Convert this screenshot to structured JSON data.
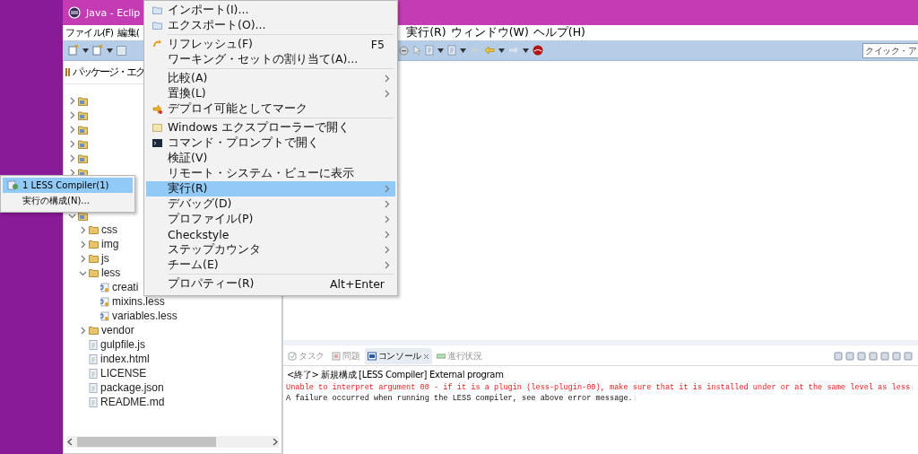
{
  "window": {
    "title": "Java - Eclip"
  },
  "menu_bar": [
    {
      "label": "ファイル(F)"
    },
    {
      "label": "編集("
    },
    {
      "label": "実行(R)"
    },
    {
      "label": "ウィンドウ(W)"
    },
    {
      "label": "ヘルプ(H)"
    }
  ],
  "quick_access": {
    "placeholder": "クイック・ア"
  },
  "package_explorer": {
    "title": "パッケージ・エク",
    "tree": [
      {
        "kind": "project",
        "expanded": false
      },
      {
        "kind": "project",
        "expanded": false
      },
      {
        "kind": "project",
        "expanded": false
      },
      {
        "kind": "project",
        "expanded": false
      },
      {
        "kind": "project",
        "expanded": false
      },
      {
        "kind": "project",
        "expanded": false
      },
      {
        "kind": "project",
        "expanded": true,
        "children": [
          {
            "kind": "folder",
            "label": "css",
            "expanded": false
          },
          {
            "kind": "folder",
            "label": "img",
            "expanded": false
          },
          {
            "kind": "folder",
            "label": "js",
            "expanded": false
          },
          {
            "kind": "folder",
            "label": "less",
            "expanded": true,
            "children": [
              {
                "kind": "less",
                "label": "creati"
              },
              {
                "kind": "less",
                "label": "mixins.less"
              },
              {
                "kind": "less",
                "label": "variables.less"
              }
            ]
          },
          {
            "kind": "folder",
            "label": "vendor",
            "expanded": false
          },
          {
            "kind": "file",
            "label": "gulpfile.js"
          },
          {
            "kind": "file",
            "label": "index.html"
          },
          {
            "kind": "file",
            "label": "LICENSE"
          },
          {
            "kind": "file",
            "label": "package.json"
          },
          {
            "kind": "file",
            "label": "README.md"
          }
        ]
      }
    ]
  },
  "context_menu": {
    "items": [
      {
        "kind": "item",
        "label": "インポート(I)...",
        "submenu": false,
        "selected": false
      },
      {
        "kind": "item",
        "label": "エクスポート(O)...",
        "submenu": false,
        "selected": false
      },
      {
        "kind": "separator"
      },
      {
        "kind": "item",
        "label": "リフレッシュ(F)",
        "shortcut": "F5",
        "submenu": false,
        "selected": false
      },
      {
        "kind": "item",
        "label": "ワーキング・セットの割り当て(A)...",
        "submenu": false,
        "selected": false
      },
      {
        "kind": "separator"
      },
      {
        "kind": "item",
        "label": "比較(A)",
        "submenu": true,
        "selected": false
      },
      {
        "kind": "item",
        "label": "置換(L)",
        "submenu": true,
        "selected": false
      },
      {
        "kind": "item",
        "label": "デプロイ可能としてマーク",
        "submenu": false,
        "selected": false
      },
      {
        "kind": "separator"
      },
      {
        "kind": "item",
        "label": "Windows エクスプローラーで開く",
        "submenu": false,
        "selected": false
      },
      {
        "kind": "item",
        "label": "コマンド・プロンプトで開く",
        "submenu": false,
        "selected": false
      },
      {
        "kind": "item",
        "label": "検証(V)",
        "submenu": false,
        "selected": false
      },
      {
        "kind": "item",
        "label": "リモート・システム・ビューに表示",
        "submenu": false,
        "selected": false
      },
      {
        "kind": "item",
        "label": "実行(R)",
        "submenu": true,
        "selected": true
      },
      {
        "kind": "item",
        "label": "デバッグ(D)",
        "submenu": true,
        "selected": false
      },
      {
        "kind": "item",
        "label": "プロファイル(P)",
        "submenu": true,
        "selected": false
      },
      {
        "kind": "item",
        "label": "Checkstyle",
        "submenu": true,
        "selected": false
      },
      {
        "kind": "item",
        "label": "ステップカウンタ",
        "submenu": true,
        "selected": false
      },
      {
        "kind": "item",
        "label": "チーム(E)",
        "submenu": true,
        "selected": false
      },
      {
        "kind": "separator"
      },
      {
        "kind": "item",
        "label": "プロパティー(R)",
        "shortcut": "Alt+Enter",
        "submenu": false,
        "selected": false
      }
    ]
  },
  "run_submenu": {
    "items": [
      {
        "label": "1 LESS Compiler(1)",
        "selected": true
      },
      {
        "label": "実行の構成(N)...",
        "selected": false
      }
    ]
  },
  "console": {
    "tabs": [
      {
        "label": "タスク",
        "selected": false
      },
      {
        "label": "問題",
        "selected": false
      },
      {
        "label": "コンソール",
        "selected": true
      },
      {
        "label": "進行状況",
        "selected": false
      }
    ],
    "header": "<終了> 新規構成 [LESS Compiler] External program",
    "lines": [
      {
        "kind": "error",
        "text": "Unable to interpret argument 00 - if it is a plugin (less-plugin-00), make sure that it is installed under or at the same level as less",
        "eol": "↓"
      },
      {
        "kind": "info",
        "text": "A failure occurred when running the LESS compiler, see above error message.",
        "eol": "↓"
      }
    ]
  }
}
